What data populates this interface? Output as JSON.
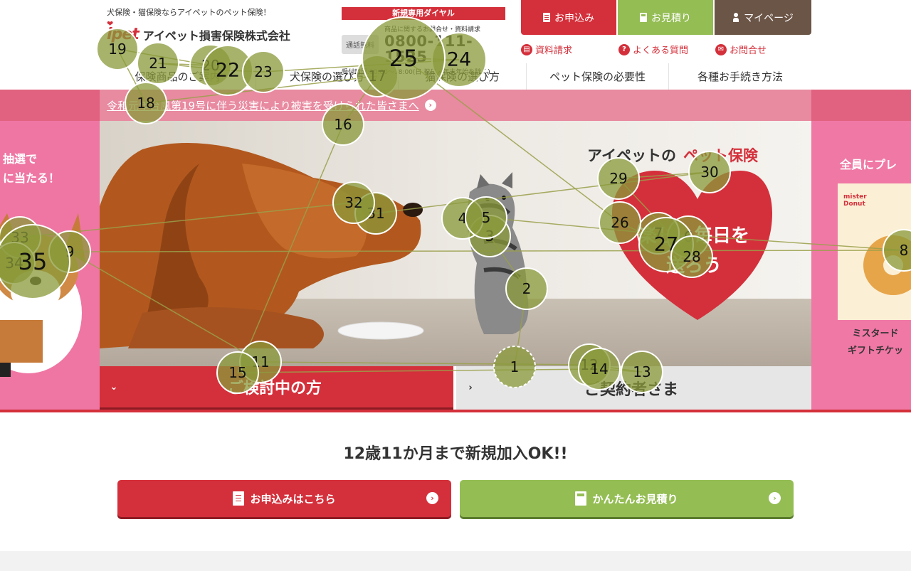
{
  "header": {
    "tagline": "犬保険・猫保険ならアイペットのペット保険！",
    "logo_mark": "ipet",
    "company_name": "アイペット損害保険株式会社",
    "dial": {
      "heading": "新規専用ダイヤル",
      "free_badge": "通話無料",
      "note": "商品に関するお問合せ・資料請求",
      "number": "0800-111-1525",
      "hours": "受付時間:10:00～18:00(日 祝日・年末年始を除く)"
    },
    "buttons": {
      "apply": "お申込み",
      "estimate": "お見積り",
      "mypage": "マイページ"
    },
    "sub_links": {
      "brochure": "資料請求",
      "faq": "よくある質問",
      "contact": "お問合せ"
    }
  },
  "nav": {
    "items": [
      "保険商品のご案内",
      "犬保険の選び方",
      "猫保険の選び方",
      "ペット保険の必要性",
      "各種お手続き方法"
    ]
  },
  "notice": {
    "text": "令和元年台風第19号に伴う災害により被害を受けられた皆さまへ"
  },
  "hero": {
    "left_banner_lines": [
      "抽選で",
      "に当たる！"
    ],
    "right_banner_text": "全員にプレ",
    "donut_brand": "mister Donut",
    "right_banner_caption": [
      "ミスタード",
      "ギフトチケッ"
    ],
    "photo_title_prefix": "アイペットの",
    "photo_title_highlight": "ペット保険",
    "heart_text": [
      "楽しい毎日を",
      "送ろう"
    ],
    "tabs": {
      "prospect": "ご検討中の方",
      "member": "ご契約者さま"
    }
  },
  "promo": {
    "headline": "12歳11か月まで新規加入OK!!",
    "apply_cta": "お申込みはこちら",
    "estimate_cta": "かんたんお見積り"
  },
  "gaze": {
    "fixations": [
      {
        "n": "1"
      },
      {
        "n": "2"
      },
      {
        "n": "3"
      },
      {
        "n": "4"
      },
      {
        "n": "5"
      },
      {
        "n": "6"
      },
      {
        "n": "7"
      },
      {
        "n": "8"
      },
      {
        "n": "9"
      },
      {
        "n": "11"
      },
      {
        "n": "12"
      },
      {
        "n": "13"
      },
      {
        "n": "14"
      },
      {
        "n": "15"
      },
      {
        "n": "16"
      },
      {
        "n": "17"
      },
      {
        "n": "18"
      },
      {
        "n": "19"
      },
      {
        "n": "20"
      },
      {
        "n": "21"
      },
      {
        "n": "22"
      },
      {
        "n": "23"
      },
      {
        "n": "24"
      },
      {
        "n": "25"
      },
      {
        "n": "26"
      },
      {
        "n": "27"
      },
      {
        "n": "28"
      },
      {
        "n": "29"
      },
      {
        "n": "30"
      },
      {
        "n": "31"
      },
      {
        "n": "32"
      },
      {
        "n": "33"
      },
      {
        "n": "34"
      },
      {
        "n": "35"
      }
    ],
    "colors": {
      "fill": "#8a9a3a",
      "stroke": "#ffffff",
      "line": "#9aa04a"
    }
  }
}
